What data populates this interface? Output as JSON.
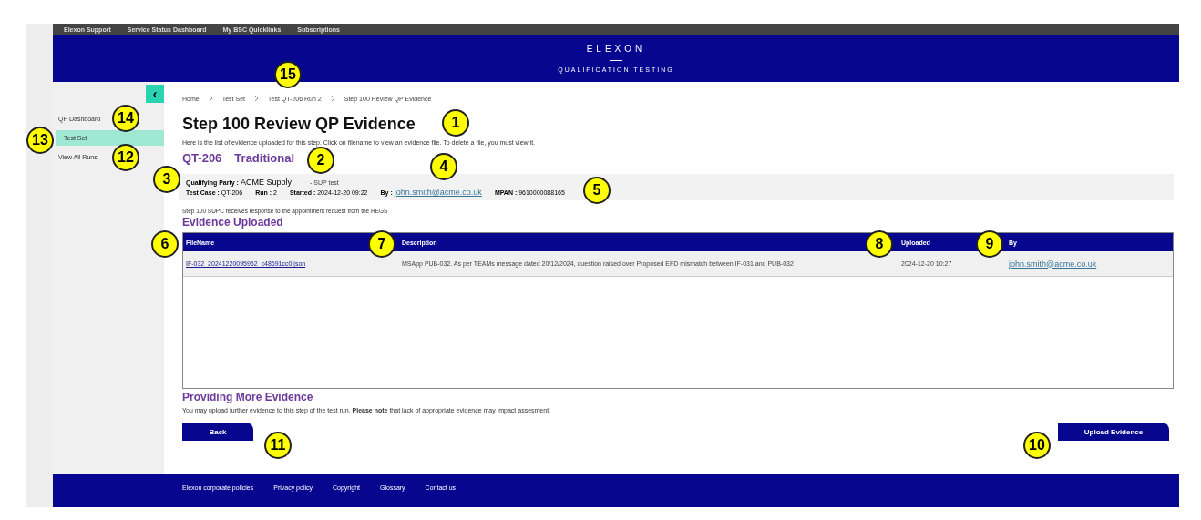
{
  "top_links": [
    "Elexon Support",
    "Service Status Dashboard",
    "My BSC Quicklinks",
    "Subscriptions"
  ],
  "header": {
    "logo": "ELEXON",
    "subtitle": "QUALIFICATION TESTING"
  },
  "sidebar": {
    "toggle": "‹",
    "items": [
      {
        "label": "QP Dashboard",
        "selected": false
      },
      {
        "label": "Test Set",
        "selected": true
      },
      {
        "label": "View All Runs",
        "selected": false
      }
    ]
  },
  "breadcrumb": [
    "Home",
    "Test Set",
    "Test QT-206 Run 2",
    "Step 100 Review QP Evidence"
  ],
  "title": "Step 100 Review QP Evidence",
  "intro": "Here is the list of evidence uploaded for this step. Click on filename to view an evidence file. To delete a file, you must view it.",
  "test": {
    "code": "QT-206",
    "type": "Traditional"
  },
  "info": {
    "party": {
      "label": "Qualifying Party :",
      "value": "ACME Supply"
    },
    "party_note": "- SUP test",
    "fields": [
      {
        "label": "Test Case :",
        "value": "QT-206",
        "kind": "text"
      },
      {
        "label": "Run :",
        "value": "2",
        "kind": "text"
      },
      {
        "label": "Started :",
        "value": "2024-12-20 09:22",
        "kind": "text"
      },
      {
        "label": "By :",
        "value": "john.smith@acme.co.uk",
        "kind": "link"
      },
      {
        "label": "MPAN :",
        "value": "9610000088165",
        "kind": "text"
      }
    ]
  },
  "step_note": "Step 100 SUPC receives response to the appointment request from the REGS",
  "evidence": {
    "heading": "Evidence Uploaded",
    "columns": [
      "FileName",
      "Description",
      "Uploaded",
      "By"
    ],
    "rows": [
      {
        "file": "IF-032_20241220095952_c48691cc0.json",
        "description": "MSApp PUB-032. As per TEAMs message dated 20/12/2024, question raised over Proposed EFD mismatch between IF-031 and PUB-032",
        "uploaded": "2024-12-20 10:27",
        "by": "john.smith@acme.co.uk"
      }
    ]
  },
  "more": {
    "heading": "Providing More Evidence",
    "text": "You may upload further evidence to this step of the test run. **Please note** that lack of appropriate evidence may impact assesment."
  },
  "buttons": {
    "back": "Back",
    "upload": "Upload Evidence"
  },
  "footer_links": [
    "Elexon corporate policies",
    "Privacy policy",
    "Copyright",
    "Glossary",
    "Contact us"
  ],
  "callouts": [
    "1",
    "2",
    "3",
    "4",
    "5",
    "6",
    "7",
    "8",
    "9",
    "10",
    "11",
    "12",
    "13",
    "14",
    "15"
  ]
}
